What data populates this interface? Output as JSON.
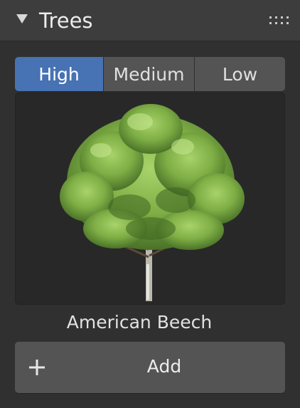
{
  "panel": {
    "title": "Trees",
    "collapsed": false,
    "icons": {
      "toggle": "disclosure-triangle-down-icon",
      "drag": "drag-handle-icon"
    }
  },
  "quality": {
    "options": [
      "High",
      "Medium",
      "Low"
    ],
    "selected": "High",
    "accent": "#4772b3"
  },
  "asset": {
    "name": "American Beech"
  },
  "add_button": {
    "label": "Add",
    "icon": "plus-icon"
  }
}
